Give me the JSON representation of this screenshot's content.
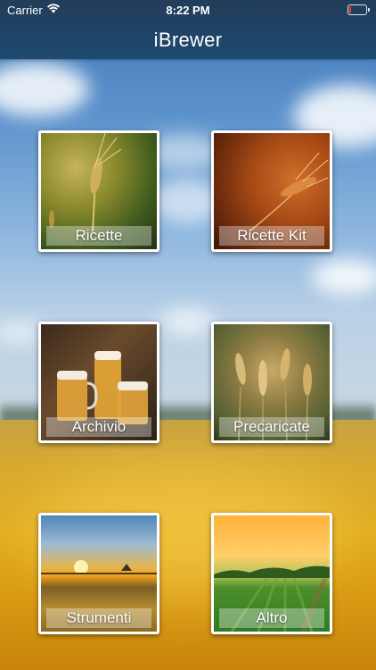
{
  "status_bar": {
    "carrier": "Carrier",
    "time": "8:22 PM",
    "battery_level": 0.1,
    "battery_color": "#ff3b30"
  },
  "nav": {
    "title": "iBrewer"
  },
  "menu": {
    "tiles": [
      {
        "label": "Ricette",
        "icon": "wheat-ear-image"
      },
      {
        "label": "Ricette Kit",
        "icon": "wheat-ear-sunset-image"
      },
      {
        "label": "Archivio",
        "icon": "beer-mugs-image"
      },
      {
        "label": "Precaricate",
        "icon": "wheat-field-image"
      },
      {
        "label": "Strumenti",
        "icon": "sunset-field-image"
      },
      {
        "label": "Altro",
        "icon": "green-field-image"
      }
    ]
  },
  "colors": {
    "navbar": "#1f4466",
    "field": "#e2ad1f",
    "sky": "#5d93cc"
  }
}
